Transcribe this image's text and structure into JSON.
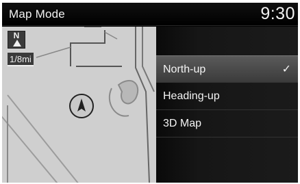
{
  "header": {
    "title": "Map Mode",
    "clock": "9:30"
  },
  "map": {
    "north_badge": "N",
    "scale": "1/8mi",
    "icons": [
      "north-up-indicator-icon",
      "vehicle-position-icon"
    ]
  },
  "menu": {
    "items": [
      {
        "label": "North-up",
        "selected": true
      },
      {
        "label": "Heading-up",
        "selected": false
      },
      {
        "label": "3D Map",
        "selected": false
      }
    ],
    "check": "✓"
  },
  "colors": {
    "background": "#000000",
    "map": "#cfcfcf",
    "selected_row": "#4a4a4a"
  }
}
